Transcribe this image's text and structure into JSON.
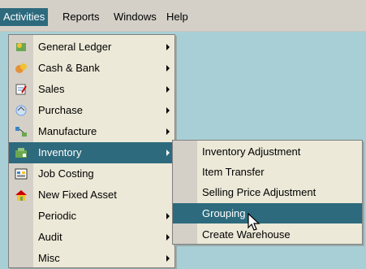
{
  "menubar": {
    "items": [
      {
        "label": "Activities"
      },
      {
        "label": "Reports"
      },
      {
        "label": "Windows"
      },
      {
        "label": "Help"
      }
    ]
  },
  "menu": {
    "items": [
      {
        "label": "General Ledger",
        "icon": "general-ledger-icon"
      },
      {
        "label": "Cash & Bank",
        "icon": "cash-bank-icon"
      },
      {
        "label": "Sales",
        "icon": "sales-icon"
      },
      {
        "label": "Purchase",
        "icon": "purchase-icon"
      },
      {
        "label": "Manufacture",
        "icon": "manufacture-icon"
      },
      {
        "label": "Inventory",
        "icon": "inventory-icon"
      },
      {
        "label": "Job Costing",
        "icon": "job-costing-icon"
      },
      {
        "label": "New Fixed Asset",
        "icon": "fixed-asset-icon"
      },
      {
        "label": "Periodic"
      },
      {
        "label": "Audit"
      },
      {
        "label": "Misc"
      }
    ]
  },
  "submenu": {
    "items": [
      {
        "label": "Inventory Adjustment"
      },
      {
        "label": "Item Transfer"
      },
      {
        "label": "Selling Price Adjustment"
      },
      {
        "label": "Grouping"
      },
      {
        "label": "Create Warehouse"
      }
    ]
  },
  "colors": {
    "highlight": "#2d6a7d",
    "menu_bg": "#ece9d8",
    "desktop": "#a9cfd6"
  }
}
